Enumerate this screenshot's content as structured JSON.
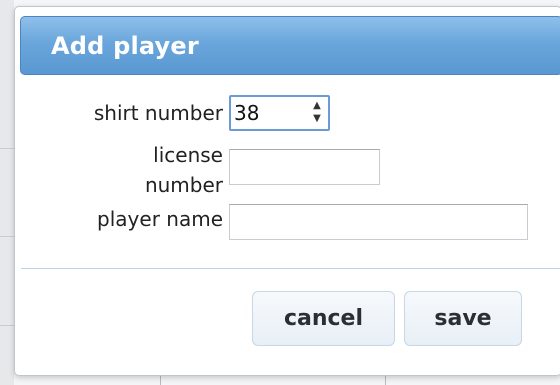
{
  "dialog": {
    "title": "Add player"
  },
  "form": {
    "shirt_number_label": "shirt number",
    "shirt_number_value": "38",
    "license_label_line1": "license",
    "license_label_line2": "number",
    "license_value": "",
    "player_name_label": "player name",
    "player_name_value": ""
  },
  "buttons": {
    "cancel_label": "cancel",
    "save_label": "save"
  },
  "icons": {
    "spin_up": "▲",
    "spin_down": "▼"
  }
}
